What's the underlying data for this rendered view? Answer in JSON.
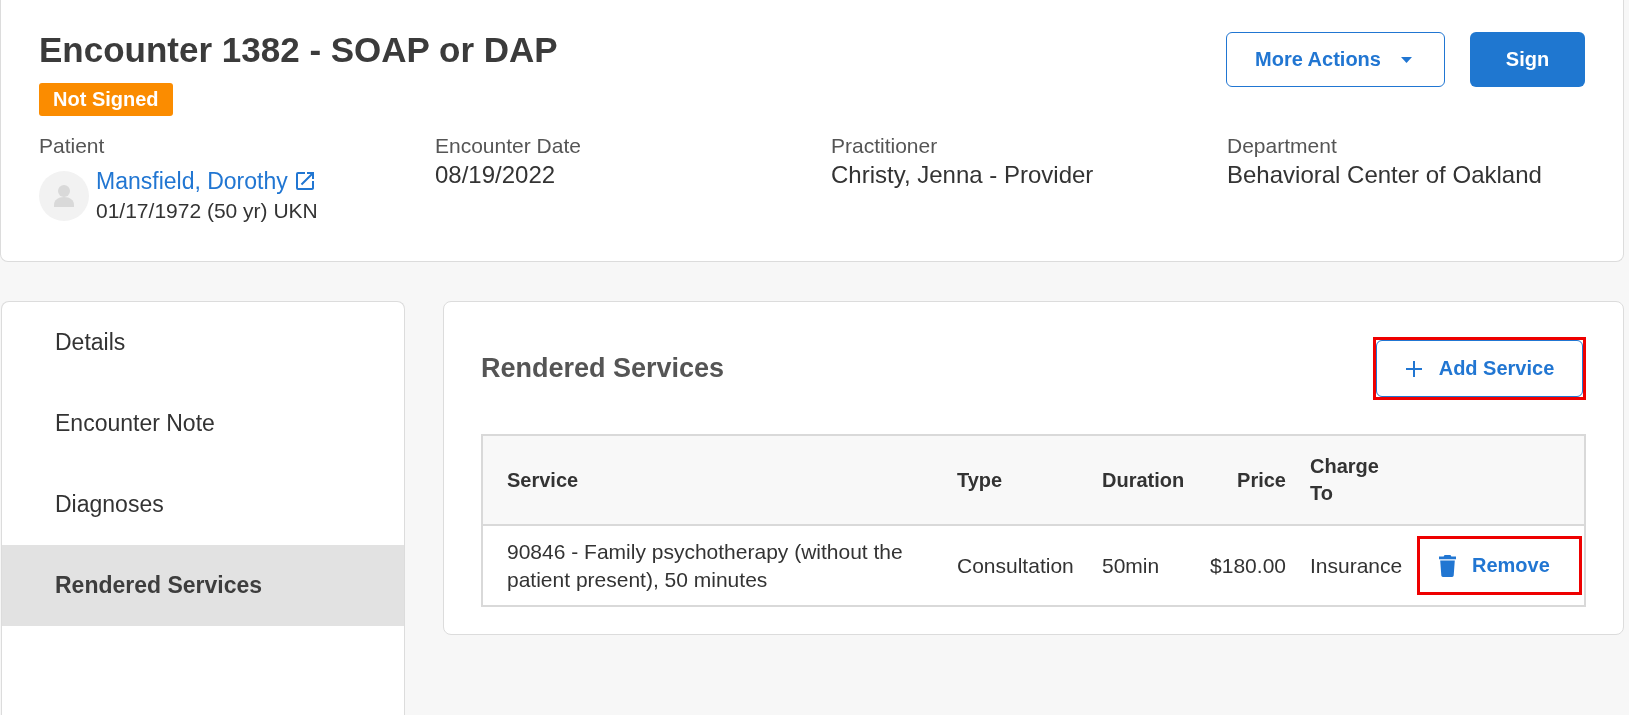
{
  "header": {
    "title": "Encounter 1382 - SOAP or DAP",
    "status_badge": "Not Signed",
    "actions": [
      {
        "kind": "dropdown",
        "label": "More Actions"
      },
      {
        "kind": "primary",
        "label": "Sign"
      }
    ],
    "fields": [
      {
        "kind": "patient",
        "label": "Patient",
        "name": "Mansfield, Dorothy",
        "details": "01/17/1972 (50 yr) UKN"
      },
      {
        "kind": "text",
        "label": "Encounter Date",
        "value": "08/19/2022"
      },
      {
        "kind": "text",
        "label": "Practitioner",
        "value": "Christy, Jenna - Provider"
      },
      {
        "kind": "text",
        "label": "Department",
        "value": "Behavioral Center of Oakland"
      }
    ]
  },
  "sidebar": {
    "items": [
      {
        "label": "Details",
        "selected": false
      },
      {
        "label": "Encounter Note",
        "selected": false
      },
      {
        "label": "Diagnoses",
        "selected": false
      },
      {
        "label": "Rendered Services",
        "selected": true
      }
    ]
  },
  "services": {
    "title": "Rendered Services",
    "add_button": {
      "label": "Add Service",
      "highlighted": true
    },
    "table": {
      "columns": [
        "Service",
        "Type",
        "Duration",
        "Price",
        "Charge To"
      ],
      "rows": [
        {
          "cells": [
            "90846 - Family psychotherapy (without the patient present), 50 minutes",
            "Consultation",
            "50min",
            "$180.00",
            "Insurance"
          ],
          "action": {
            "label": "Remove",
            "highlighted": true
          }
        }
      ]
    }
  }
}
